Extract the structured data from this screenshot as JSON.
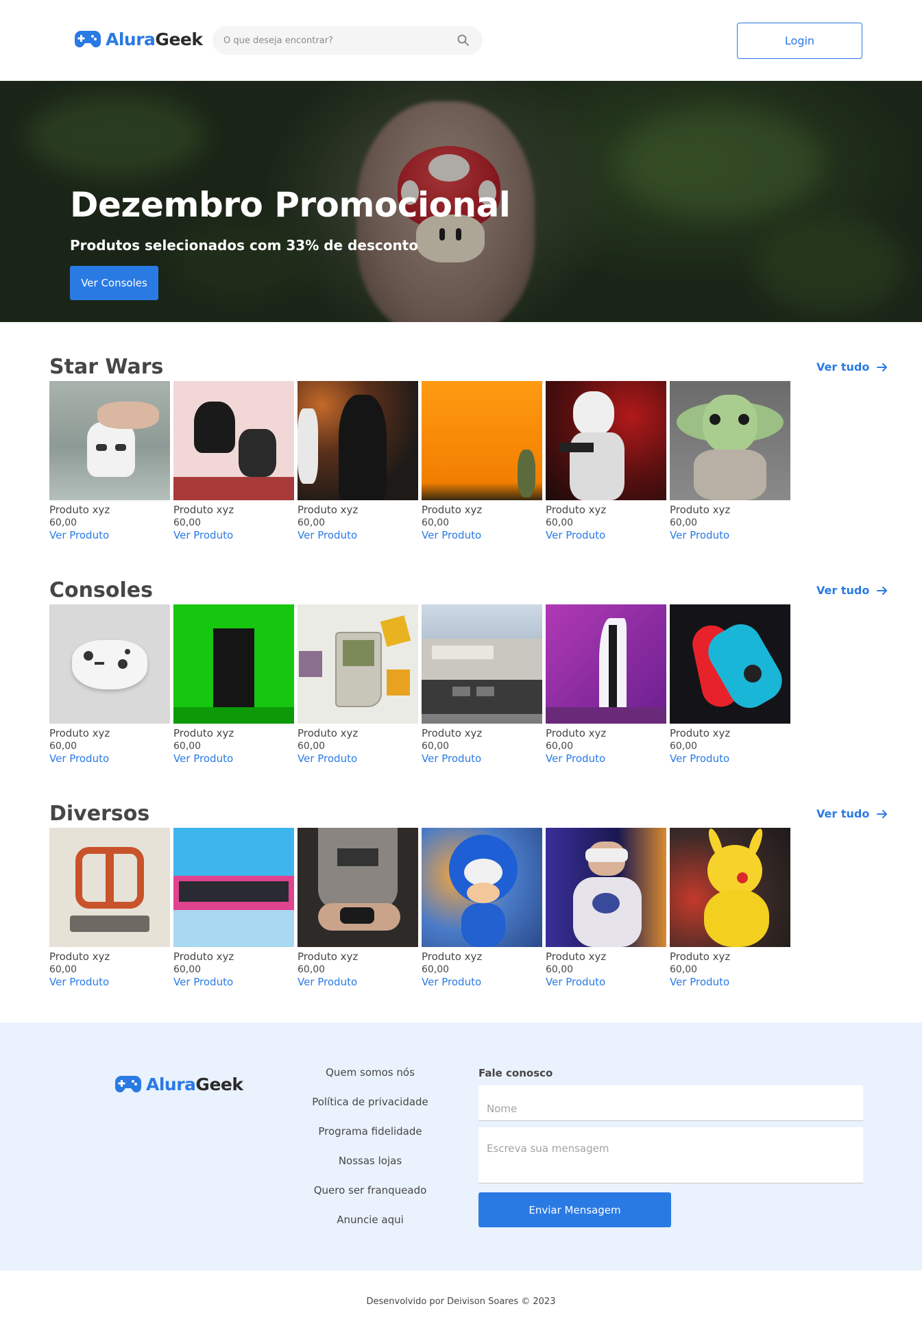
{
  "brand": {
    "name_part1": "Alura",
    "name_part2": "Geek"
  },
  "search": {
    "placeholder": "O que deseja encontrar?"
  },
  "header": {
    "login_label": "Login"
  },
  "banner": {
    "title": "Dezembro Promocional",
    "subtitle": "Produtos selecionados com 33% de desconto",
    "button_label": "Ver Consoles"
  },
  "sections": [
    {
      "title": "Star Wars",
      "see_all": "Ver tudo",
      "products": [
        {
          "name": "Produto xyz",
          "price": "60,00",
          "link": "Ver Produto"
        },
        {
          "name": "Produto xyz",
          "price": "60,00",
          "link": "Ver Produto"
        },
        {
          "name": "Produto xyz",
          "price": "60,00",
          "link": "Ver Produto"
        },
        {
          "name": "Produto xyz",
          "price": "60,00",
          "link": "Ver Produto"
        },
        {
          "name": "Produto xyz",
          "price": "60,00",
          "link": "Ver Produto"
        },
        {
          "name": "Produto xyz",
          "price": "60,00",
          "link": "Ver Produto"
        }
      ]
    },
    {
      "title": "Consoles",
      "see_all": "Ver tudo",
      "products": [
        {
          "name": "Produto xyz",
          "price": "60,00",
          "link": "Ver Produto"
        },
        {
          "name": "Produto xyz",
          "price": "60,00",
          "link": "Ver Produto"
        },
        {
          "name": "Produto xyz",
          "price": "60,00",
          "link": "Ver Produto"
        },
        {
          "name": "Produto xyz",
          "price": "60,00",
          "link": "Ver Produto"
        },
        {
          "name": "Produto xyz",
          "price": "60,00",
          "link": "Ver Produto"
        },
        {
          "name": "Produto xyz",
          "price": "60,00",
          "link": "Ver Produto"
        }
      ]
    },
    {
      "title": "Diversos",
      "see_all": "Ver tudo",
      "products": [
        {
          "name": "Produto xyz",
          "price": "60,00",
          "link": "Ver Produto"
        },
        {
          "name": "Produto xyz",
          "price": "60,00",
          "link": "Ver Produto"
        },
        {
          "name": "Produto xyz",
          "price": "60,00",
          "link": "Ver Produto"
        },
        {
          "name": "Produto xyz",
          "price": "60,00",
          "link": "Ver Produto"
        },
        {
          "name": "Produto xyz",
          "price": "60,00",
          "link": "Ver Produto"
        },
        {
          "name": "Produto xyz",
          "price": "60,00",
          "link": "Ver Produto"
        }
      ]
    }
  ],
  "footer": {
    "links": [
      "Quem somos nós",
      "Política de privacidade",
      "Programa fidelidade",
      "Nossas lojas",
      "Quero ser franqueado",
      "Anuncie aqui"
    ],
    "contact_title": "Fale conosco",
    "name_placeholder": "Nome",
    "message_placeholder": "Escreva sua mensagem",
    "send_label": "Enviar Mensagem"
  },
  "credits": "Desenvolvido por Deivison Soares © 2023",
  "colors": {
    "accent": "#2A7AE4",
    "text": "#464646",
    "footer_bg": "#EAF2FD"
  }
}
